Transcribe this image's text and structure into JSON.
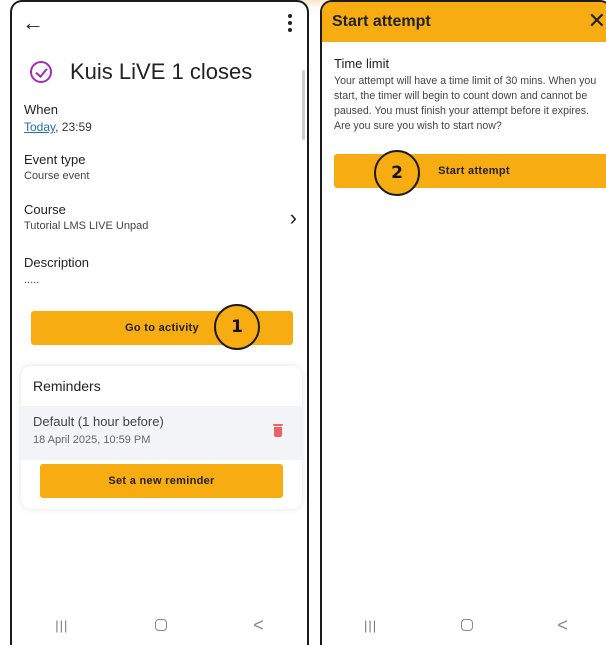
{
  "left_screen": {
    "event_title": "Kuis LiVE 1 closes",
    "when": {
      "label": "When",
      "date_link": "Today",
      "time": ", 23:59"
    },
    "event_type": {
      "label": "Event type",
      "value": "Course event"
    },
    "course": {
      "label": "Course",
      "value": "Tutorial LMS LIVE Unpad"
    },
    "description": {
      "label": "Description",
      "value": "....."
    },
    "go_to_activity_label": "Go to activity",
    "step_badge": "1",
    "reminders": {
      "heading": "Reminders",
      "item_title": "Default (1 hour before)",
      "item_date": "18 April 2025, 10:59 PM",
      "set_new_label": "Set a new reminder"
    },
    "navbar": {
      "recent": "|||",
      "back": "<"
    }
  },
  "right_screen": {
    "header_title": "Start attempt",
    "close_glyph": "✕",
    "time_limit_label": "Time limit",
    "time_limit_text": "Your attempt will have a time limit of 30 mins. When you start, the timer will begin to count down and cannot be paused. You must finish your attempt before it expires. Are you sure you wish to start now?",
    "start_attempt_label": "Start attempt",
    "step_badge": "2",
    "navbar": {
      "recent": "|||",
      "back": "<"
    }
  },
  "colors": {
    "accent": "#f7ac12",
    "event_icon": "#a62fb0",
    "link": "#1e6fb3",
    "delete": "#e86464"
  },
  "icons": [
    "back-arrow-icon",
    "more-vertical-icon",
    "event-check-icon",
    "chevron-right-icon",
    "trash-icon",
    "close-icon"
  ]
}
